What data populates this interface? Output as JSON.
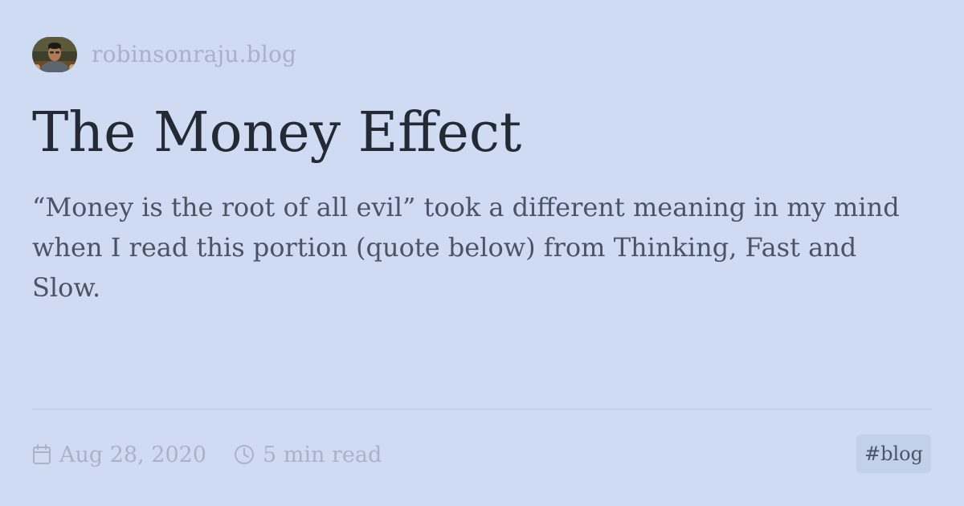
{
  "site": {
    "avatar_icon": "author-avatar-photo",
    "name": "robinsonraju.blog"
  },
  "post": {
    "title": "The Money Effect",
    "description": "“Money is the root of all evil” took a different meaning in my mind when I read this portion (quote below) from Thinking, Fast and Slow."
  },
  "meta": {
    "date_icon": "calendar-icon",
    "date": "Aug 28, 2020",
    "read_icon": "clock-icon",
    "read_time": "5 min read"
  },
  "tags": [
    {
      "label": "#blog"
    }
  ],
  "colors": {
    "background": "#cfdaf3",
    "title": "#232a33",
    "description": "#4a5464",
    "muted": "#a9b3c6",
    "tag_background": "#c3d0ea"
  }
}
